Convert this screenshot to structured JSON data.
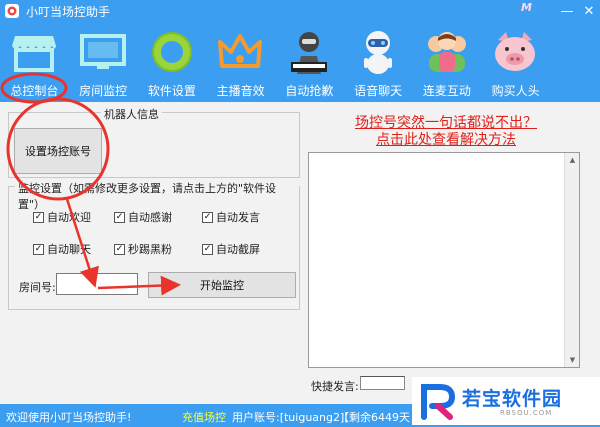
{
  "window": {
    "title": "小叮当场控助手",
    "brand_mark": "M"
  },
  "toolbar": {
    "items": [
      {
        "label": "总控制台"
      },
      {
        "label": "房间监控"
      },
      {
        "label": "软件设置"
      },
      {
        "label": "主播音效"
      },
      {
        "label": "自动抢歉"
      },
      {
        "label": "语音聊天"
      },
      {
        "label": "连麦互动"
      },
      {
        "label": "购买人头"
      }
    ]
  },
  "robot_info": {
    "legend": "机器人信息",
    "set_account_button": "设置场控账号"
  },
  "monitor_settings": {
    "legend": "监控设置（如需修改更多设置，请点击上方的\"软件设置\"）",
    "checkboxes": [
      {
        "label": "自动欢迎",
        "checked": true
      },
      {
        "label": "自动感谢",
        "checked": true
      },
      {
        "label": "自动发言",
        "checked": true
      },
      {
        "label": "自动聊天",
        "checked": true
      },
      {
        "label": "秒踢黑粉",
        "checked": true
      },
      {
        "label": "自动截屏",
        "checked": true
      }
    ],
    "room_label": "房间号:",
    "room_value": "",
    "start_button": "开始监控"
  },
  "notice": {
    "line1": "场控号突然一句话都说不出？",
    "line2": "点击此处查看解决方法"
  },
  "quick_speech": {
    "label": "快捷发言:",
    "value": ""
  },
  "statusbar": {
    "welcome": "欢迎使用小叮当场控助手!",
    "recharge": "充值场控",
    "account": "用户账号:[tuiguang2]",
    "remaining": "【剩余6449天"
  },
  "watermark": {
    "text": "若宝软件园",
    "url": "RBSOU.COM"
  },
  "colors": {
    "accent": "#3b9ef0",
    "notice": "#e0211b",
    "annotation": "#e8342c",
    "toolbar_icon": "#b6f0ef"
  },
  "icons": [
    "store-icon",
    "monitor-icon",
    "settings-ring-icon",
    "crown-icon",
    "robot-icon",
    "voice-robot-icon",
    "group-chat-icon",
    "pig-icon"
  ]
}
